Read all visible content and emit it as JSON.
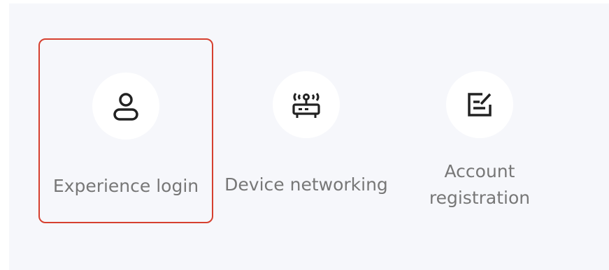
{
  "options": [
    {
      "label": "Experience login",
      "icon": "user-icon",
      "selected": true
    },
    {
      "label": "Device networking",
      "icon": "router-icon",
      "selected": false
    },
    {
      "label": "Account registration",
      "icon": "edit-icon",
      "selected": false
    }
  ],
  "colors": {
    "background": "#f6f7fb",
    "circle": "#ffffff",
    "icon": "#222222",
    "label": "#777777",
    "selected_border": "#d6402f"
  }
}
